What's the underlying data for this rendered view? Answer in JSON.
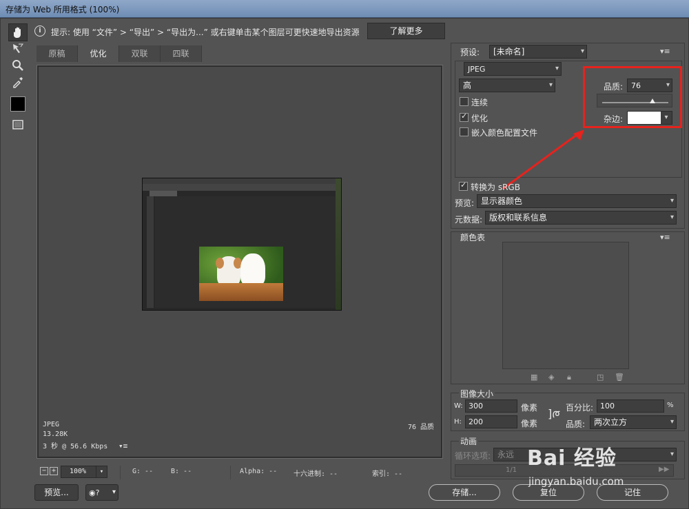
{
  "window": {
    "title": "存储为 Web 所用格式 (100%)"
  },
  "info": {
    "text": "提示: 使用 “文件” > “导出” > “导出为...” 或右键单击某个图层可更快速地导出资源",
    "learn_more": "了解更多"
  },
  "tabs": [
    {
      "label": "原稿"
    },
    {
      "label": "优化"
    },
    {
      "label": "双联"
    },
    {
      "label": "四联"
    }
  ],
  "canvas_status": {
    "format": "JPEG",
    "size": "13.28K",
    "time": "3 秒 @ 56.6 Kbps",
    "quality": "76 品质"
  },
  "bottombar": {
    "zoom": "100%",
    "g": "G: --",
    "b": "B: --",
    "alpha": "Alpha: --",
    "hex": "十六进制: --",
    "index": "索引: --"
  },
  "buttons": {
    "preview": "预览...",
    "save": "存储...",
    "reset": "复位",
    "remember": "记住"
  },
  "settings": {
    "preset_label": "预设:",
    "preset_value": "[未命名]",
    "format": "JPEG",
    "quality_level": "高",
    "quality_label": "品质:",
    "quality_value": "76",
    "quality_fraction": 0.76,
    "progressive": "连续",
    "optimized": "优化",
    "embed_profile": "嵌入颜色配置文件",
    "matte_label": "杂边:",
    "convert_srgb": "转换为 sRGB",
    "preview_label": "预览:",
    "preview_value": "显示器颜色",
    "metadata_label": "元数据:",
    "metadata_value": "版权和联系信息"
  },
  "color_table": {
    "title": "颜色表"
  },
  "image_size": {
    "title": "图像大小",
    "w_label": "W:",
    "w_value": "300",
    "w_unit": "像素",
    "h_label": "H:",
    "h_value": "200",
    "h_unit": "像素",
    "percent_label": "百分比:",
    "percent_value": "100",
    "percent_unit": "%",
    "quality_label": "品质:",
    "quality_value": "两次立方"
  },
  "animation": {
    "title": "动画",
    "loop_label": "循环选项:",
    "loop_value": "永远",
    "frame": "1/1"
  },
  "watermark": {
    "text": "Bai 经验",
    "url": "jingyan.baidu.com"
  },
  "colors": {
    "accent_red": "#e8221d",
    "matte": "#ffffff"
  }
}
